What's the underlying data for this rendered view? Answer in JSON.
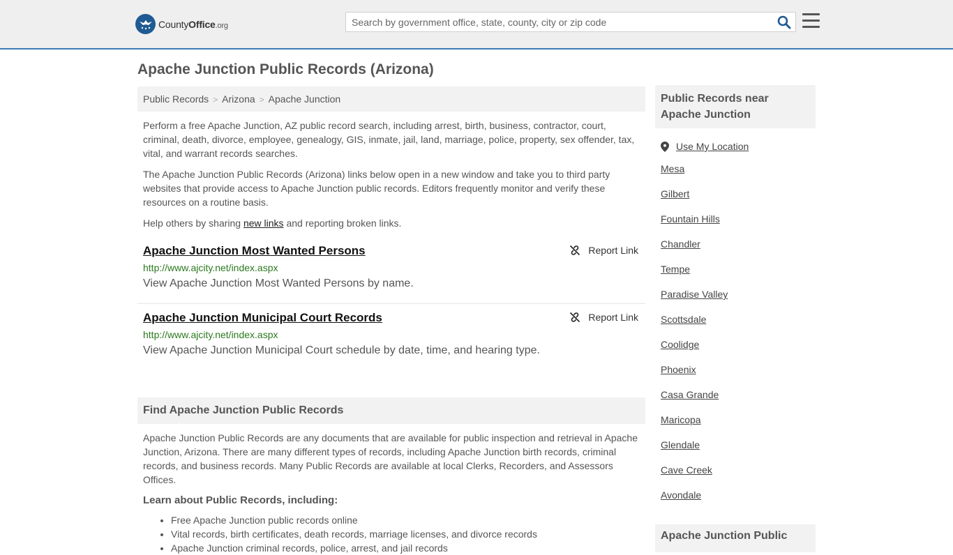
{
  "header": {
    "logo": {
      "county": "County",
      "office": "Office",
      "org": ".org"
    },
    "search_placeholder": "Search by government office, state, county, city or zip code"
  },
  "page_title": "Apache Junction Public Records (Arizona)",
  "breadcrumb": [
    "Public Records",
    "Arizona",
    "Apache Junction"
  ],
  "intro": {
    "p1": "Perform a free Apache Junction, AZ public record search, including arrest, birth, business, contractor, court, criminal, death, divorce, employee, genealogy, GIS, inmate, jail, land, marriage, police, property, sex offender, tax, vital, and warrant records searches.",
    "p2": "The Apache Junction Public Records (Arizona) links below open in a new window and take you to third party websites that provide access to Apache Junction public records. Editors frequently monitor and verify these resources on a routine basis.",
    "p3_before": "Help others by sharing ",
    "p3_link": "new links",
    "p3_after": " and reporting broken links."
  },
  "records": [
    {
      "title": "Apache Junction Most Wanted Persons",
      "url": "http://www.ajcity.net/index.aspx",
      "desc": "View Apache Junction Most Wanted Persons by name.",
      "report": "Report Link"
    },
    {
      "title": "Apache Junction Municipal Court Records",
      "url": "http://www.ajcity.net/index.aspx",
      "desc": "View Apache Junction Municipal Court schedule by date, time, and hearing type.",
      "report": "Report Link"
    }
  ],
  "find_section": {
    "heading": "Find Apache Junction Public Records",
    "text": "Apache Junction Public Records are any documents that are available for public inspection and retrieval in Apache Junction, Arizona. There are many different types of records, including Apache Junction birth records, criminal records, and business records. Many Public Records are available at local Clerks, Recorders, and Assessors Offices.",
    "learn_heading": "Learn about Public Records, including:",
    "learn_items": [
      "Free Apache Junction public records online",
      "Vital records, birth certificates, death records, marriage licenses, and divorce records",
      "Apache Junction criminal records, police, arrest, and jail records"
    ]
  },
  "sidebar": {
    "heading": "Public Records near Apache Junction",
    "use_location": "Use My Location",
    "cities": [
      "Mesa",
      "Gilbert",
      "Fountain Hills",
      "Chandler",
      "Tempe",
      "Paradise Valley",
      "Scottsdale",
      "Coolidge",
      "Phoenix",
      "Casa Grande",
      "Maricopa",
      "Glendale",
      "Cave Creek",
      "Avondale"
    ],
    "heading2": "Apache Junction Public"
  },
  "colors": {
    "accent": "#3a7cb6",
    "logo_blue": "#1f5a92",
    "url_green": "#2c7a1f"
  }
}
